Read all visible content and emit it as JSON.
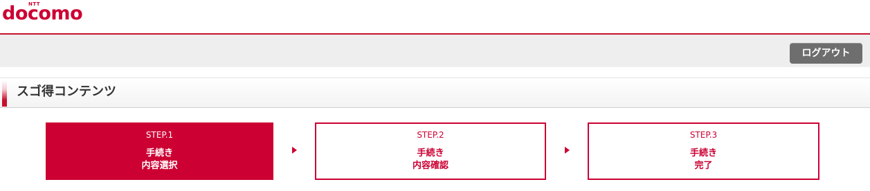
{
  "header": {
    "logo_brand": "NTT",
    "logo_word": "docomo"
  },
  "toolbar": {
    "logout_label": "ログアウト"
  },
  "section": {
    "title": "スゴ得コンテンツ"
  },
  "steps": [
    {
      "number": "STEP.1",
      "line1": "手続き",
      "line2": "内容選択",
      "state": "active"
    },
    {
      "number": "STEP.2",
      "line1": "手続き",
      "line2": "内容確認",
      "state": "inactive"
    },
    {
      "number": "STEP.3",
      "line1": "手続き",
      "line2": "完了",
      "state": "inactive"
    }
  ],
  "colors": {
    "brand_red": "#cc0033",
    "toolbar_bg": "#eeeeee",
    "logout_bg": "#6e6e6e"
  },
  "icons": [
    "step-arrow-icon"
  ]
}
